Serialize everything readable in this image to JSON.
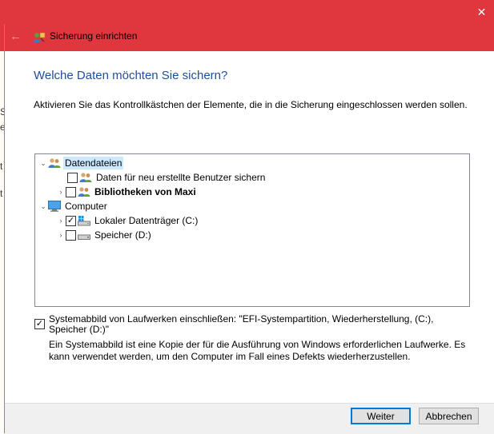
{
  "window": {
    "close_glyph": "✕"
  },
  "background_fragments": [
    "S",
    "e",
    "t",
    "t"
  ],
  "nav": {
    "title": "Sicherung einrichten",
    "back_glyph": "←"
  },
  "heading": "Welche Daten möchten Sie sichern?",
  "instruction": "Aktivieren Sie das Kontrollkästchen der Elemente, die in die Sicherung eingeschlossen werden sollen.",
  "tree": {
    "items": [
      {
        "label": "Datendateien",
        "expander": "collapse",
        "checkbox": false,
        "icon": "users-icon",
        "selected": true,
        "bold": false
      },
      {
        "label": "Daten für neu erstellte Benutzer sichern",
        "expander": "none",
        "checkbox": true,
        "checked": false,
        "icon": "users-icon",
        "bold": false
      },
      {
        "label": "Bibliotheken von Maxi",
        "expander": "expand",
        "checkbox": true,
        "checked": false,
        "icon": "users-icon",
        "bold": true
      },
      {
        "label": "Computer",
        "expander": "collapse",
        "checkbox": false,
        "icon": "monitor-icon",
        "bold": false
      },
      {
        "label": "Lokaler Datenträger (C:)",
        "expander": "expand",
        "checkbox": true,
        "checked": true,
        "icon": "windows-drive-icon",
        "bold": false
      },
      {
        "label": "Speicher (D:)",
        "expander": "expand",
        "checkbox": true,
        "checked": false,
        "icon": "drive-icon",
        "bold": false
      }
    ]
  },
  "system_image": {
    "checked": true,
    "label": "Systemabbild von Laufwerken einschließen: \"EFI-Systempartition, Wiederherstellung, (C:), Speicher (D:)\"",
    "description": "Ein Systemabbild ist eine Kopie der für die Ausführung von Windows erforderlichen Laufwerke. Es kann verwendet werden, um den Computer im Fall eines Defekts wiederherzustellen."
  },
  "buttons": {
    "next": "Weiter",
    "cancel": "Abbrechen"
  },
  "colors": {
    "titlebar": "#e0363d",
    "heading": "#1f4e9f",
    "selection": "#cce8ff",
    "accent": "#0078d7"
  },
  "glyphs": {
    "check": "✓",
    "expand": "›",
    "collapse": "⌄"
  }
}
